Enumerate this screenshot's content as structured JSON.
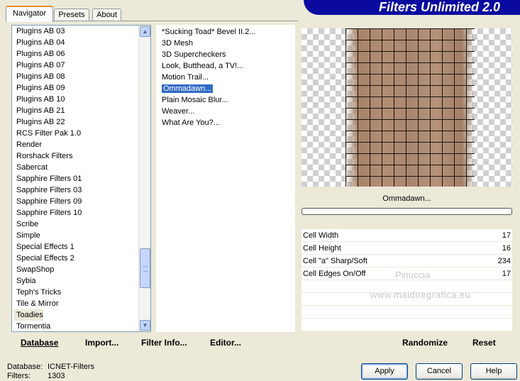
{
  "tabs": [
    "Navigator",
    "Presets",
    "About"
  ],
  "banner_title": "Filters Unlimited 2.0",
  "categories": [
    "Plugins AB 03",
    "Plugins AB 04",
    "Plugins AB 06",
    "Plugins AB 07",
    "Plugins AB 08",
    "Plugins AB 09",
    "Plugins AB 10",
    "Plugins AB 21",
    "Plugins AB 22",
    "RCS Filter Pak 1.0",
    "Render",
    "Rorshack Filters",
    "Sabercat",
    "Sapphire Filters 01",
    "Sapphire Filters 03",
    "Sapphire Filters 09",
    "Sapphire Filters 10",
    "Scribe",
    "Simple",
    "Special Effects 1",
    "Special Effects 2",
    "SwapShop",
    "Sybia",
    "Teph's Tricks",
    "Tile & Mirror",
    "Toadies",
    "Tormentia"
  ],
  "selected_category": "Toadies",
  "filters": [
    "*Sucking Toad*  Bevel II.2...",
    "3D Mesh",
    "3D Supercheckers",
    "Look, Butthead, a TV!...",
    "Motion Trail...",
    "Ommadawn...",
    "Plain Mosaic Blur...",
    "Weaver...",
    "What Are You?..."
  ],
  "selected_filter": "Ommadawn...",
  "preview_filter_name": "Ommadawn...",
  "params": [
    {
      "label": "Cell Width",
      "value": "17"
    },
    {
      "label": "Cell Height",
      "value": "16"
    },
    {
      "label": "Cell \"a\" Sharp/Soft",
      "value": "234"
    },
    {
      "label": "Cell Edges On/Off",
      "value": "17"
    }
  ],
  "watermark": {
    "line1": "Pinuccia",
    "line2": "www.maidiregrafica.eu"
  },
  "bottom_buttons": {
    "database": "Database",
    "import": "Import...",
    "filter_info": "Filter Info...",
    "editor": "Editor...",
    "randomize": "Randomize",
    "reset": "Reset"
  },
  "status": {
    "database_label": "Database:",
    "database_value": "ICNET-Filters",
    "filters_label": "Filters:",
    "filters_value": "1303"
  },
  "dialog_buttons": {
    "apply": "Apply",
    "cancel": "Cancel",
    "help": "Help"
  }
}
